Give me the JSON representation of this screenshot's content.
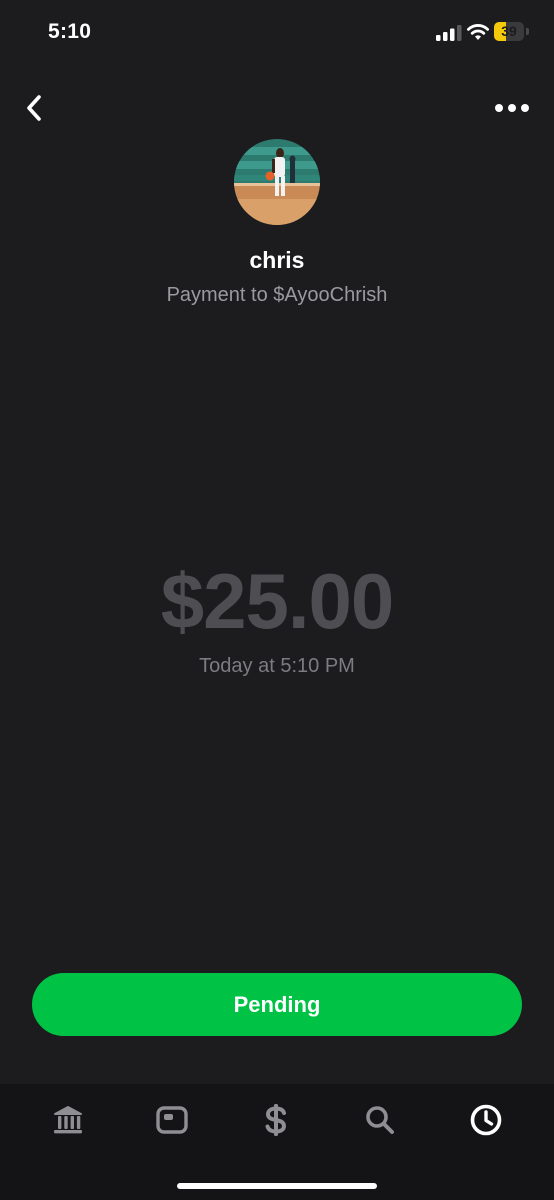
{
  "status_bar": {
    "time": "5:10",
    "battery_level": "39",
    "battery_color": "#f4c90a",
    "signal_bars_active": 3,
    "signal_bars_total": 4
  },
  "header": {
    "back_icon": "chevron-left-icon",
    "more_icon": "more-horizontal-icon"
  },
  "recipient": {
    "name": "chris",
    "subtitle": "Payment to $AyooChrish"
  },
  "payment": {
    "amount": "$25.00",
    "timestamp": "Today at 5:10 PM",
    "status": "Pending"
  },
  "tab_bar": {
    "active_tab": "activity",
    "tabs": [
      {
        "id": "banking",
        "icon": "bank-icon"
      },
      {
        "id": "card",
        "icon": "card-icon"
      },
      {
        "id": "money",
        "icon": "dollar-icon"
      },
      {
        "id": "search",
        "icon": "search-icon"
      },
      {
        "id": "activity",
        "icon": "clock-icon"
      }
    ]
  },
  "colors": {
    "background": "#1c1c1e",
    "accent_green": "#00c244",
    "muted_text": "#9a9a9f",
    "amount_text": "#4e4e52",
    "tab_inactive": "#8e8e93",
    "tab_active": "#ffffff"
  }
}
